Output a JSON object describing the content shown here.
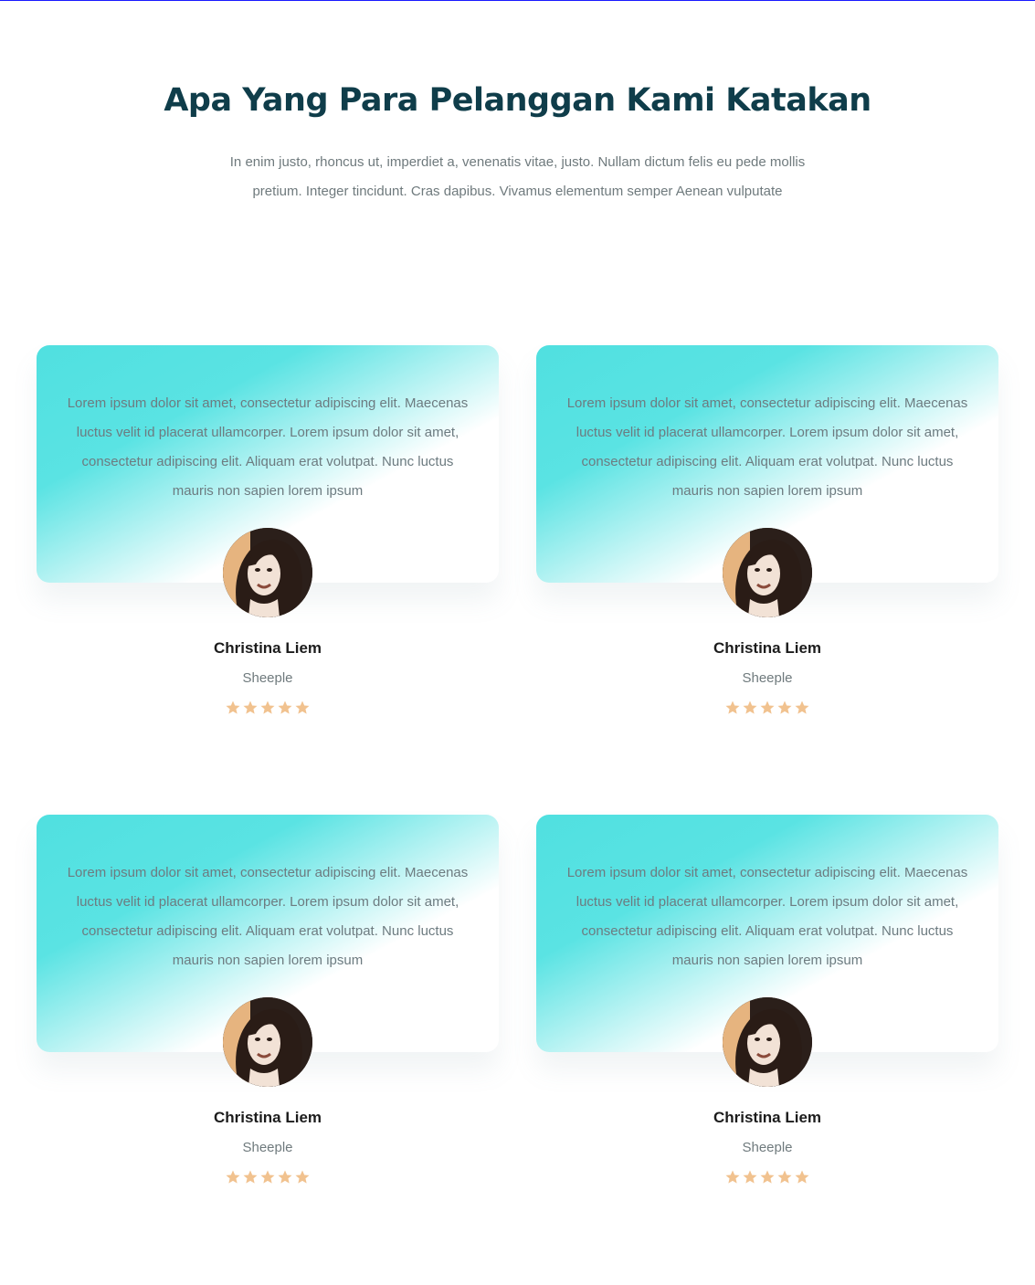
{
  "header": {
    "title": "Apa Yang Para Pelanggan Kami Katakan",
    "subtitle": "In enim justo, rhoncus ut, imperdiet a, venenatis vitae, justo. Nullam dictum felis eu pede mollis pretium. Integer tincidunt. Cras dapibus. Vivamus elementum semper Aenean vulputate"
  },
  "testimonials": [
    {
      "quote": "Lorem ipsum dolor sit amet, consectetur adipiscing elit. Maecenas luctus velit id placerat ullamcorper. Lorem ipsum dolor sit amet, consectetur adipiscing elit. Aliquam erat volutpat. Nunc luctus mauris non sapien lorem ipsum",
      "name": "Christina Liem",
      "company": "Sheeple",
      "rating": 5
    },
    {
      "quote": "Lorem ipsum dolor sit amet, consectetur adipiscing elit. Maecenas luctus velit id placerat ullamcorper. Lorem ipsum dolor sit amet, consectetur adipiscing elit. Aliquam erat volutpat. Nunc luctus mauris non sapien lorem ipsum",
      "name": "Christina Liem",
      "company": "Sheeple",
      "rating": 5
    },
    {
      "quote": "Lorem ipsum dolor sit amet, consectetur adipiscing elit. Maecenas luctus velit id placerat ullamcorper. Lorem ipsum dolor sit amet, consectetur adipiscing elit. Aliquam erat volutpat. Nunc luctus mauris non sapien lorem ipsum",
      "name": "Christina Liem",
      "company": "Sheeple",
      "rating": 5
    },
    {
      "quote": "Lorem ipsum dolor sit amet, consectetur adipiscing elit. Maecenas luctus velit id placerat ullamcorper. Lorem ipsum dolor sit amet, consectetur adipiscing elit. Aliquam erat volutpat. Nunc luctus mauris non sapien lorem ipsum",
      "name": "Christina Liem",
      "company": "Sheeple",
      "rating": 5
    }
  ],
  "colors": {
    "title": "#0f3d4a",
    "accent_gradient": "#50e0e0",
    "star": "#f1c28f",
    "body_text": "#6f7a7d"
  },
  "icons": {
    "star": "star-icon"
  }
}
